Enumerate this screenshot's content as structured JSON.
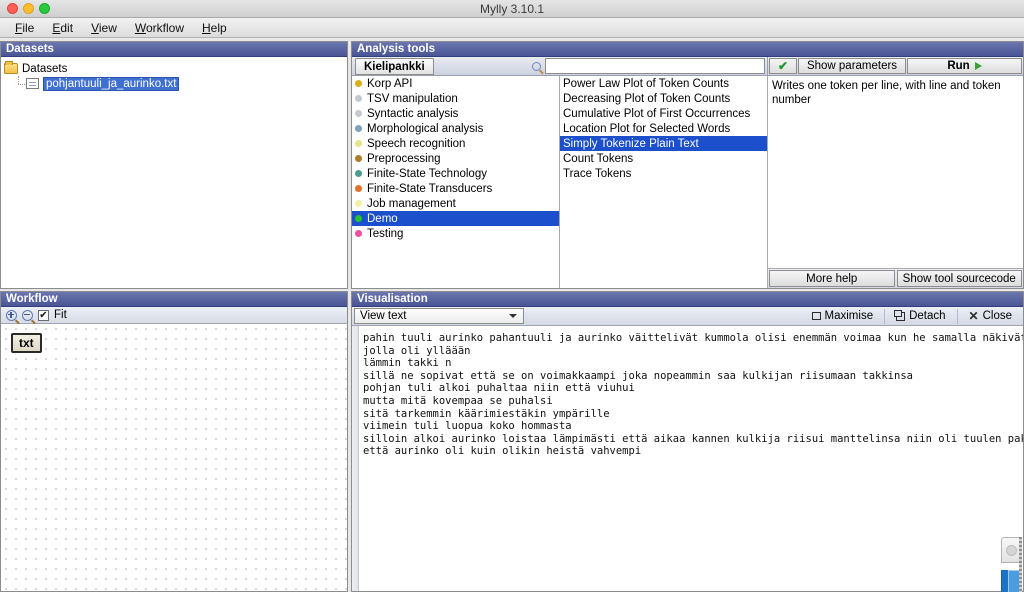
{
  "window": {
    "title": "Mylly 3.10.1",
    "traffic_lights": [
      "close",
      "minimize",
      "zoom"
    ]
  },
  "menubar": {
    "items": [
      {
        "label": "File",
        "mnemonic": "F"
      },
      {
        "label": "Edit",
        "mnemonic": "E"
      },
      {
        "label": "View",
        "mnemonic": "V"
      },
      {
        "label": "Workflow",
        "mnemonic": "W"
      },
      {
        "label": "Help",
        "mnemonic": "H"
      }
    ]
  },
  "datasets": {
    "title": "Datasets",
    "root_label": "Datasets",
    "items": [
      {
        "label": "pohjantuuli_ja_aurinko.txt",
        "selected": true
      }
    ]
  },
  "tools": {
    "title": "Analysis tools",
    "tab_label": "Kielipankki",
    "search_value": "",
    "search_placeholder": "",
    "ok_symbol": "✔",
    "show_parameters_label": "Show parameters",
    "run_label": "Run",
    "categories": [
      {
        "label": "Korp API",
        "color": "#d7b018",
        "selected": false
      },
      {
        "label": "TSV manipulation",
        "color": "#c3c9ce",
        "selected": false
      },
      {
        "label": "Syntactic analysis",
        "color": "#c3c9ce",
        "selected": false
      },
      {
        "label": "Morphological analysis",
        "color": "#7fa1bd",
        "selected": false
      },
      {
        "label": "Speech recognition",
        "color": "#e4e58a",
        "selected": false
      },
      {
        "label": "Preprocessing",
        "color": "#b07c2a",
        "selected": false
      },
      {
        "label": "Finite-State Technology",
        "color": "#4c9b91",
        "selected": false
      },
      {
        "label": "Finite-State Transducers",
        "color": "#e2702a",
        "selected": false
      },
      {
        "label": "Job management",
        "color": "#f4f1a6",
        "selected": false
      },
      {
        "label": "Demo",
        "color": "#27c12b",
        "selected": true
      },
      {
        "label": "Testing",
        "color": "#ec4fa0",
        "selected": false
      }
    ],
    "tool_items": [
      {
        "label": "Power Law Plot of Token Counts",
        "selected": false
      },
      {
        "label": "Decreasing Plot of Token Counts",
        "selected": false
      },
      {
        "label": "Cumulative Plot of First Occurrences",
        "selected": false
      },
      {
        "label": "Location Plot for Selected Words",
        "selected": false
      },
      {
        "label": "Simply Tokenize Plain Text",
        "selected": true
      },
      {
        "label": "Count Tokens",
        "selected": false
      },
      {
        "label": "Trace Tokens",
        "selected": false
      }
    ],
    "description": "Writes one token per line, with line and token number",
    "more_help_label": "More help",
    "show_sourcecode_label": "Show tool sourcecode"
  },
  "workflow": {
    "title": "Workflow",
    "zoom_in_label": "zoom-in",
    "zoom_out_label": "zoom-out",
    "fit_label": "Fit",
    "fit_checked": true,
    "fit_check_glyph": "✔",
    "nodes": [
      {
        "label": "txt"
      }
    ]
  },
  "visualisation": {
    "title": "Visualisation",
    "view_selected": "View text",
    "maximise_label": "Maximise",
    "detach_label": "Detach",
    "close_label": "Close",
    "text": "pahin tuuli aurinko pahantuuli ja aurinko väittelivät kummola olisi enemmän voimaa kun he samalla näkivät kulkijan\njolla oli ylläään\nlämmin takki n\nsillä ne sopivat että se on voimakkaampi joka nopeammin saa kulkijan riisumaan takkinsa\npohjan tuli alkoi puhaltaa niin että viuhui\nmutta mitä kovempaa se puhalsi\nsitä tarkemmin käärimiestäkin ympärille\nviimein tuli luopua koko hommasta\nsilloin alkoi aurinko loistaa lämpimästi että aikaa kannen kulkija riisui manttelinsa niin oli tuulen pakko myöntää\nettä aurinko oli kuin olikin heistä vahvempi"
  },
  "colors": {
    "panel_header": "#4a5596",
    "selection": "#1b4fcb",
    "accent_green": "#27c12b"
  }
}
